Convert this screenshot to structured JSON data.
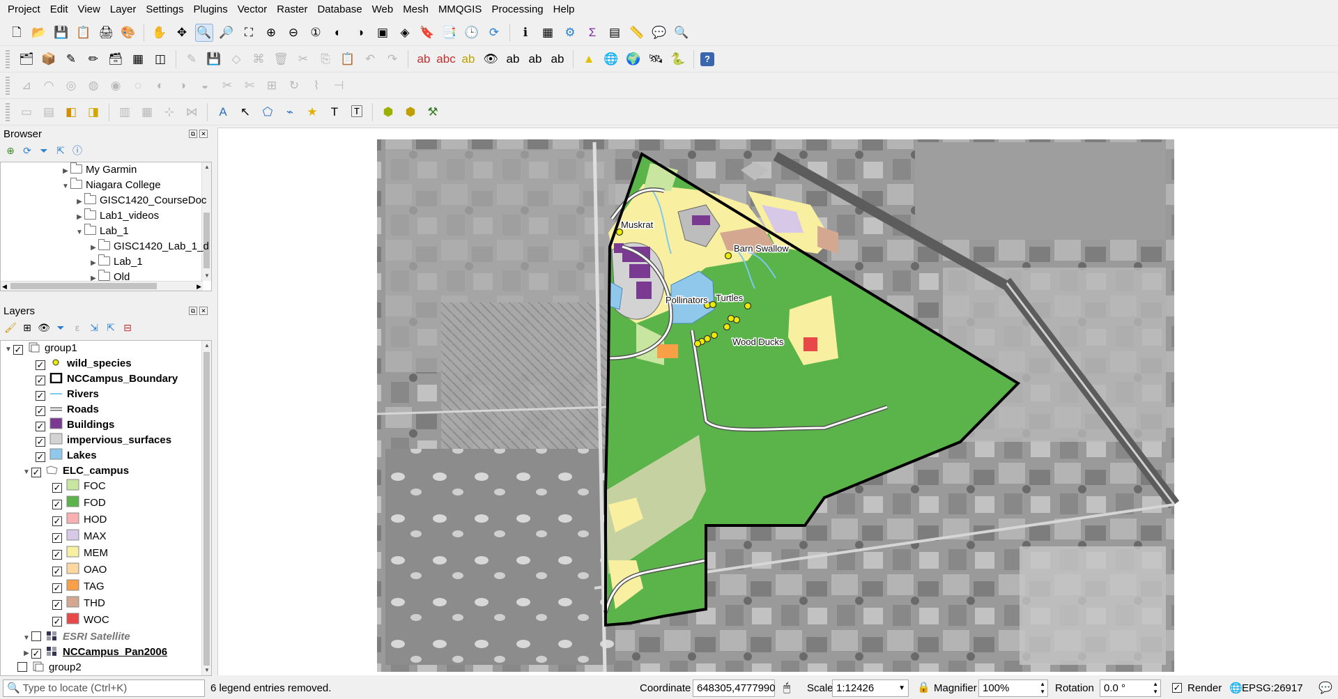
{
  "menu": [
    "Project",
    "Edit",
    "View",
    "Layer",
    "Settings",
    "Plugins",
    "Vector",
    "Raster",
    "Database",
    "Web",
    "Mesh",
    "MMQGIS",
    "Processing",
    "Help"
  ],
  "browser": {
    "title": "Browser",
    "items": [
      {
        "label": "My Garmin",
        "level": 0,
        "arrow": "right"
      },
      {
        "label": "Niagara College",
        "level": 0,
        "arrow": "down"
      },
      {
        "label": "GISC1420_CourseDoc",
        "level": 1,
        "arrow": "right"
      },
      {
        "label": "Lab1_videos",
        "level": 1,
        "arrow": "right"
      },
      {
        "label": "Lab_1",
        "level": 1,
        "arrow": "down"
      },
      {
        "label": "GISC1420_Lab_1_d",
        "level": 2,
        "arrow": "right"
      },
      {
        "label": "Lab_1",
        "level": 2,
        "arrow": "right"
      },
      {
        "label": "Old",
        "level": 2,
        "arrow": "right"
      }
    ]
  },
  "layers": {
    "title": "Layers",
    "items": [
      {
        "label": "group1",
        "type": "group",
        "checked": true,
        "expanded": true
      },
      {
        "label": "wild_species",
        "type": "point",
        "checked": true,
        "color": "#e8e800"
      },
      {
        "label": "NCCampus_Boundary",
        "type": "boundary",
        "checked": true,
        "color": "#000000"
      },
      {
        "label": "Rivers",
        "type": "line",
        "checked": true,
        "color": "#7ec8ee"
      },
      {
        "label": "Roads",
        "type": "road",
        "checked": true,
        "color": "#888888"
      },
      {
        "label": "Buildings",
        "type": "fill",
        "checked": true,
        "color": "#7b3a92"
      },
      {
        "label": "impervious_surfaces",
        "type": "fill",
        "checked": true,
        "color": "#d3d3d3"
      },
      {
        "label": "Lakes",
        "type": "fill",
        "checked": true,
        "color": "#8fc8ea"
      },
      {
        "label": "ELC_campus",
        "type": "polygroup",
        "checked": true,
        "expanded": true
      },
      {
        "label": "FOC",
        "type": "class",
        "checked": true,
        "color": "#c8e6a0"
      },
      {
        "label": "FOD",
        "type": "class",
        "checked": true,
        "color": "#5ab44a"
      },
      {
        "label": "HOD",
        "type": "class",
        "checked": true,
        "color": "#f8b0b0"
      },
      {
        "label": "MAX",
        "type": "class",
        "checked": true,
        "color": "#d6c8e6"
      },
      {
        "label": "MEM",
        "type": "class",
        "checked": true,
        "color": "#f8f0a0"
      },
      {
        "label": "OAO",
        "type": "class",
        "checked": true,
        "color": "#fcd8a0"
      },
      {
        "label": "TAG",
        "type": "class",
        "checked": true,
        "color": "#f8a048"
      },
      {
        "label": "THD",
        "type": "class",
        "checked": true,
        "color": "#d4a890"
      },
      {
        "label": "WOC",
        "type": "class",
        "checked": true,
        "color": "#e84848"
      },
      {
        "label": "ESRI Satellite",
        "type": "raster-off",
        "checked": false
      },
      {
        "label": "NCCampus_Pan2006",
        "type": "raster",
        "checked": true
      },
      {
        "label": "group2",
        "type": "group",
        "checked": false,
        "expanded": false
      }
    ]
  },
  "map_labels": [
    "Muskrat",
    "Barn Swallow",
    "Pollinators",
    "Turtles",
    "Wood Ducks"
  ],
  "status": {
    "locate_placeholder": "Type to locate (Ctrl+K)",
    "message": "6 legend entries removed.",
    "coordinate_label": "Coordinate",
    "coordinate_value": "648305,4777990",
    "scale_label": "Scale",
    "scale_value": "1:12426",
    "magnifier_label": "Magnifier",
    "magnifier_value": "100%",
    "rotation_label": "Rotation",
    "rotation_value": "0.0 °",
    "render_label": "Render",
    "crs": "EPSG:26917"
  }
}
